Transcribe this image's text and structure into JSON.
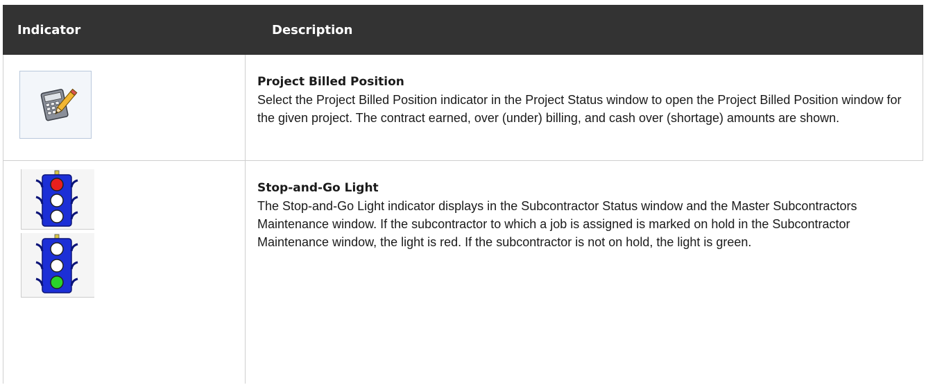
{
  "table": {
    "headers": [
      "Indicator",
      "Description"
    ],
    "rows": [
      {
        "icon": "calculator-pencil-icon",
        "title": "Project Billed Position",
        "text": "Select the Project Billed Position indicator in the Project Status window to open the Project Billed Position window for the given project. The contract earned, over (under) billing, and cash over (shortage) amounts are shown."
      },
      {
        "icons": [
          "traffic-light-red-icon",
          "traffic-light-green-icon"
        ],
        "title": "Stop-and-Go Light",
        "text": "The Stop-and-Go Light indicator displays in the Subcontractor Status window and the Master Subcontractors Maintenance window. If the subcontractor to which a job is assigned is marked on hold in the Subcontractor Maintenance window, the light is red. If the subcontractor is not on hold, the light is green."
      }
    ]
  },
  "colors": {
    "header_bg": "#333333",
    "header_text": "#ffffff",
    "border": "#cfcfcf",
    "light_red": "#e8201e",
    "light_green": "#2ad32a",
    "light_housing": "#1c2fd6"
  }
}
